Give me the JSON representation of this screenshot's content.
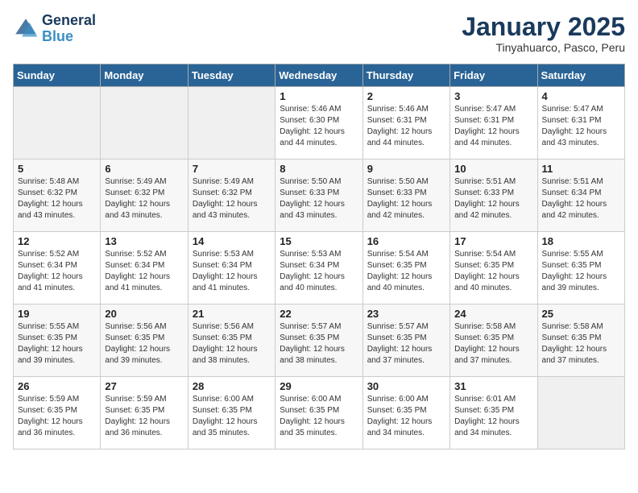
{
  "logo": {
    "line1": "General",
    "line2": "Blue"
  },
  "title": "January 2025",
  "subtitle": "Tinyahuarco, Pasco, Peru",
  "weekdays": [
    "Sunday",
    "Monday",
    "Tuesday",
    "Wednesday",
    "Thursday",
    "Friday",
    "Saturday"
  ],
  "weeks": [
    [
      {
        "day": "",
        "info": ""
      },
      {
        "day": "",
        "info": ""
      },
      {
        "day": "",
        "info": ""
      },
      {
        "day": "1",
        "info": "Sunrise: 5:46 AM\nSunset: 6:30 PM\nDaylight: 12 hours\nand 44 minutes."
      },
      {
        "day": "2",
        "info": "Sunrise: 5:46 AM\nSunset: 6:31 PM\nDaylight: 12 hours\nand 44 minutes."
      },
      {
        "day": "3",
        "info": "Sunrise: 5:47 AM\nSunset: 6:31 PM\nDaylight: 12 hours\nand 44 minutes."
      },
      {
        "day": "4",
        "info": "Sunrise: 5:47 AM\nSunset: 6:31 PM\nDaylight: 12 hours\nand 43 minutes."
      }
    ],
    [
      {
        "day": "5",
        "info": "Sunrise: 5:48 AM\nSunset: 6:32 PM\nDaylight: 12 hours\nand 43 minutes."
      },
      {
        "day": "6",
        "info": "Sunrise: 5:49 AM\nSunset: 6:32 PM\nDaylight: 12 hours\nand 43 minutes."
      },
      {
        "day": "7",
        "info": "Sunrise: 5:49 AM\nSunset: 6:32 PM\nDaylight: 12 hours\nand 43 minutes."
      },
      {
        "day": "8",
        "info": "Sunrise: 5:50 AM\nSunset: 6:33 PM\nDaylight: 12 hours\nand 43 minutes."
      },
      {
        "day": "9",
        "info": "Sunrise: 5:50 AM\nSunset: 6:33 PM\nDaylight: 12 hours\nand 42 minutes."
      },
      {
        "day": "10",
        "info": "Sunrise: 5:51 AM\nSunset: 6:33 PM\nDaylight: 12 hours\nand 42 minutes."
      },
      {
        "day": "11",
        "info": "Sunrise: 5:51 AM\nSunset: 6:34 PM\nDaylight: 12 hours\nand 42 minutes."
      }
    ],
    [
      {
        "day": "12",
        "info": "Sunrise: 5:52 AM\nSunset: 6:34 PM\nDaylight: 12 hours\nand 41 minutes."
      },
      {
        "day": "13",
        "info": "Sunrise: 5:52 AM\nSunset: 6:34 PM\nDaylight: 12 hours\nand 41 minutes."
      },
      {
        "day": "14",
        "info": "Sunrise: 5:53 AM\nSunset: 6:34 PM\nDaylight: 12 hours\nand 41 minutes."
      },
      {
        "day": "15",
        "info": "Sunrise: 5:53 AM\nSunset: 6:34 PM\nDaylight: 12 hours\nand 40 minutes."
      },
      {
        "day": "16",
        "info": "Sunrise: 5:54 AM\nSunset: 6:35 PM\nDaylight: 12 hours\nand 40 minutes."
      },
      {
        "day": "17",
        "info": "Sunrise: 5:54 AM\nSunset: 6:35 PM\nDaylight: 12 hours\nand 40 minutes."
      },
      {
        "day": "18",
        "info": "Sunrise: 5:55 AM\nSunset: 6:35 PM\nDaylight: 12 hours\nand 39 minutes."
      }
    ],
    [
      {
        "day": "19",
        "info": "Sunrise: 5:55 AM\nSunset: 6:35 PM\nDaylight: 12 hours\nand 39 minutes."
      },
      {
        "day": "20",
        "info": "Sunrise: 5:56 AM\nSunset: 6:35 PM\nDaylight: 12 hours\nand 39 minutes."
      },
      {
        "day": "21",
        "info": "Sunrise: 5:56 AM\nSunset: 6:35 PM\nDaylight: 12 hours\nand 38 minutes."
      },
      {
        "day": "22",
        "info": "Sunrise: 5:57 AM\nSunset: 6:35 PM\nDaylight: 12 hours\nand 38 minutes."
      },
      {
        "day": "23",
        "info": "Sunrise: 5:57 AM\nSunset: 6:35 PM\nDaylight: 12 hours\nand 37 minutes."
      },
      {
        "day": "24",
        "info": "Sunrise: 5:58 AM\nSunset: 6:35 PM\nDaylight: 12 hours\nand 37 minutes."
      },
      {
        "day": "25",
        "info": "Sunrise: 5:58 AM\nSunset: 6:35 PM\nDaylight: 12 hours\nand 37 minutes."
      }
    ],
    [
      {
        "day": "26",
        "info": "Sunrise: 5:59 AM\nSunset: 6:35 PM\nDaylight: 12 hours\nand 36 minutes."
      },
      {
        "day": "27",
        "info": "Sunrise: 5:59 AM\nSunset: 6:35 PM\nDaylight: 12 hours\nand 36 minutes."
      },
      {
        "day": "28",
        "info": "Sunrise: 6:00 AM\nSunset: 6:35 PM\nDaylight: 12 hours\nand 35 minutes."
      },
      {
        "day": "29",
        "info": "Sunrise: 6:00 AM\nSunset: 6:35 PM\nDaylight: 12 hours\nand 35 minutes."
      },
      {
        "day": "30",
        "info": "Sunrise: 6:00 AM\nSunset: 6:35 PM\nDaylight: 12 hours\nand 34 minutes."
      },
      {
        "day": "31",
        "info": "Sunrise: 6:01 AM\nSunset: 6:35 PM\nDaylight: 12 hours\nand 34 minutes."
      },
      {
        "day": "",
        "info": ""
      }
    ]
  ]
}
